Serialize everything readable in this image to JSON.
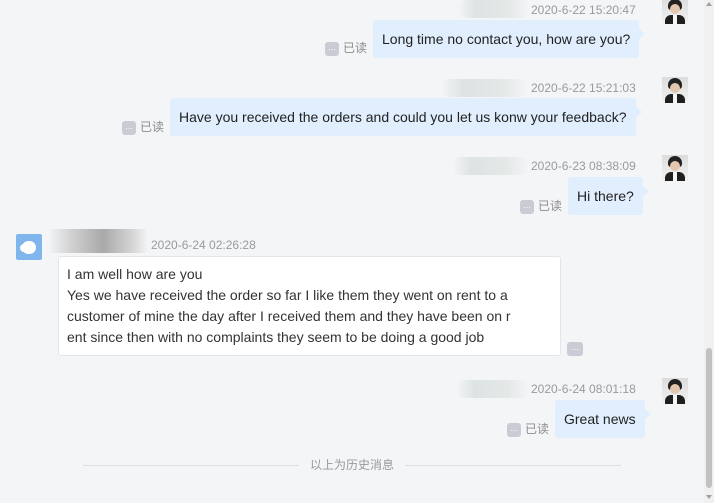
{
  "messages": [
    {
      "time": "2020-6-22 15:20:47",
      "text": "Long time no contact you, how are you?",
      "status": "已读",
      "status_icon": "..."
    },
    {
      "time": "2020-6-22 15:21:03",
      "text": "Have you received the orders and could you let us konw your feedback?",
      "status": "已读",
      "status_icon": "..."
    },
    {
      "time": "2020-6-23 08:38:09",
      "text": "Hi  there?",
      "status": "已读",
      "status_icon": "..."
    },
    {
      "time": "2020-6-24 02:26:28",
      "lines": [
        "I am well how are you",
        "Yes we have received the order so far I like them they went on rent to a",
        "customer of mine the day after I received them and they have been on r",
        "ent since then with no complaints they seem to be doing a good job"
      ],
      "more_icon": "..."
    },
    {
      "time": "2020-6-24 08:01:18",
      "text": "Great news",
      "status": "已读",
      "status_icon": "..."
    }
  ],
  "history_divider": "以上为历史消息",
  "colors": {
    "outgoing_bubble": "#e1eefd",
    "incoming_bubble": "#ffffff",
    "background": "#f4f5f7",
    "read_icon": "#c9ccd4"
  },
  "icons": {
    "self_avatar": "person-in-suit",
    "contact_avatar": "blue-cloud",
    "read_more": "ellipsis-icon"
  }
}
